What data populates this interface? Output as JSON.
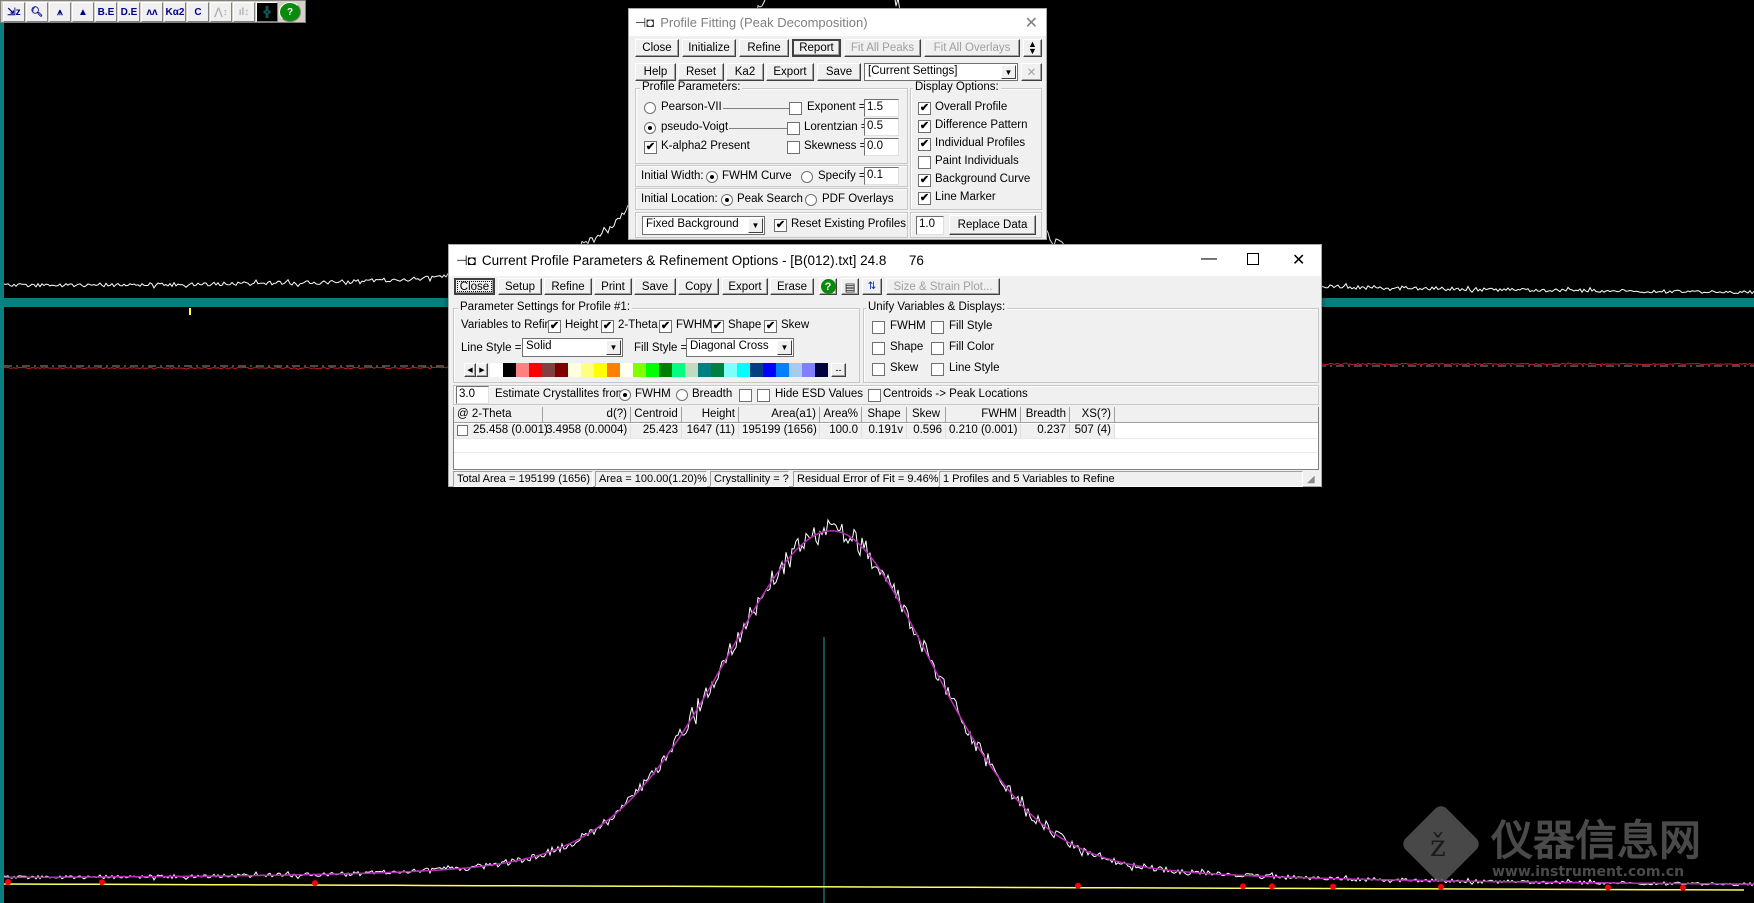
{
  "colors": {
    "panel_divider": "#0b7f7f",
    "data_trace": "#ffffff",
    "fit_trace": "#b030b0",
    "background_curve": "#ffff66",
    "difference_trace": "#cc2020",
    "line_marker": "#20a0a0",
    "markers": "#ff0000"
  },
  "toolbar": {
    "buttons": [
      {
        "icon": "zoom-select-icon",
        "glyph": "⇲z",
        "enabled": true
      },
      {
        "icon": "magnifier-icon",
        "glyph": "🔍︎",
        "enabled": true
      },
      {
        "icon": "peak-marker-icon",
        "glyph": "⩚",
        "enabled": true
      },
      {
        "icon": "filled-peaks-icon",
        "glyph": "▲",
        "enabled": true
      },
      {
        "icon": "background-edit-icon",
        "glyph": "B.E",
        "enabled": true
      },
      {
        "icon": "data-edit-icon",
        "glyph": "D.E",
        "enabled": true
      },
      {
        "icon": "peak-outline-icon",
        "glyph": "ʌʌ",
        "enabled": true
      },
      {
        "icon": "ka2-icon",
        "glyph": "Kα2",
        "enabled": true
      },
      {
        "icon": "centroid-icon",
        "glyph": "C",
        "enabled": true
      },
      {
        "icon": "scale-peaks-icon",
        "glyph": "⋀↕",
        "enabled": false
      },
      {
        "icon": "scale-bars-icon",
        "glyph": "ıl↕",
        "enabled": false
      },
      {
        "icon": "grid-icon",
        "glyph": "╬",
        "enabled": true
      },
      {
        "icon": "help-icon",
        "glyph": "?",
        "enabled": true
      }
    ]
  },
  "profile_fitting": {
    "title": "Profile Fitting (Peak Decomposition)",
    "row1": [
      "Close",
      "Initialize",
      "Refine",
      "Report",
      "Fit All Peaks",
      "Fit All Overlays"
    ],
    "row2": [
      "Help",
      "Reset",
      "Ka2",
      "Export",
      "Save"
    ],
    "settings_select": "[Current Settings]",
    "profile_parameters": {
      "label": "Profile Parameters:",
      "pearson": {
        "label": "Pearson-VII",
        "selected": false
      },
      "pseudo": {
        "label": "pseudo-Voigt",
        "selected": true
      },
      "kalpha2": {
        "label": "K-alpha2 Present",
        "checked": true
      },
      "exponent": {
        "label": "Exponent =",
        "checked": false,
        "value": "1.5"
      },
      "lorentzian": {
        "label": "Lorentzian =",
        "checked": false,
        "value": "0.5"
      },
      "skewness": {
        "label": "Skewness =",
        "checked": false,
        "value": "0.0"
      }
    },
    "initial_width": {
      "label": "Initial Width:",
      "fwhm": {
        "label": "FWHM Curve",
        "selected": true
      },
      "specify": {
        "label": "Specify =",
        "selected": false
      },
      "value": "0.1"
    },
    "initial_location": {
      "label": "Initial Location:",
      "peak": {
        "label": "Peak Search",
        "selected": true
      },
      "pdf": {
        "label": "PDF Overlays",
        "selected": false
      }
    },
    "background_select": "Fixed Background",
    "reset_profiles": {
      "label": "Reset Existing Profiles",
      "checked": true
    },
    "display_options": {
      "label": "Display Options:",
      "items": [
        {
          "label": "Overall Profile",
          "checked": true
        },
        {
          "label": "Difference Pattern",
          "checked": true
        },
        {
          "label": "Individual Profiles",
          "checked": true
        },
        {
          "label": "Paint Individuals",
          "checked": false
        },
        {
          "label": "Background Curve",
          "checked": true
        },
        {
          "label": "Line Marker",
          "checked": true
        }
      ]
    },
    "scale_value": "1.0",
    "replace_data": "Replace Data"
  },
  "current_profile": {
    "title": "Current Profile Parameters & Refinement Options - [B(012).txt] 24.8      76",
    "toolbar": [
      "Close",
      "Setup",
      "Refine",
      "Print",
      "Save",
      "Copy",
      "Export",
      "Erase"
    ],
    "size_strain": "Size & Strain Plot...",
    "param_group": "Parameter Settings for Profile #1:",
    "variables_label": "Variables to Refine:",
    "variables": [
      {
        "label": "Height",
        "checked": true
      },
      {
        "label": "2-Theta",
        "checked": true
      },
      {
        "label": "FWHM",
        "checked": true
      },
      {
        "label": "Shape",
        "checked": true
      },
      {
        "label": "Skew",
        "checked": true
      }
    ],
    "line_style_label": "Line Style =",
    "line_style": "Solid",
    "fill_style_label": "Fill Style =",
    "fill_style": "Diagonal Cross",
    "palette": [
      "#ffffff",
      "#000000",
      "#ff8080",
      "#ff0000",
      "#804040",
      "#800000",
      "#ffffe0",
      "#ffff80",
      "#ffff00",
      "#ff8000",
      "#fffff0",
      "#80ff00",
      "#00ff00",
      "#008000",
      "#00ff80",
      "#c0dcc0",
      "#008080",
      "#008040",
      "#80ffff",
      "#00ffff",
      "#004080",
      "#0000ff",
      "#0080ff",
      "#a6caf0",
      "#8080ff",
      "#000040"
    ],
    "palette_more": "--",
    "unify_group": "Unify Variables & Displays:",
    "unify": [
      {
        "label": "FWHM",
        "checked": false
      },
      {
        "label": "Fill Style",
        "checked": false
      },
      {
        "label": "Shape",
        "checked": false
      },
      {
        "label": "Fill Color",
        "checked": false
      },
      {
        "label": "Skew",
        "checked": false
      },
      {
        "label": "Line Style",
        "checked": false
      }
    ],
    "crystallite_value": "3.0",
    "estimate_label": "Estimate Crystallites from:",
    "fwhm_radio": {
      "label": "FWHM",
      "selected": true
    },
    "breadth_radio": {
      "label": "Breadth",
      "selected": false
    },
    "blank_check": false,
    "hide_esd": {
      "label": "Hide ESD Values",
      "checked": false
    },
    "centroids": {
      "label": "Centroids -> Peak Locations",
      "checked": false
    },
    "columns": [
      "@ 2-Theta",
      "d(?)",
      "Centroid",
      "Height",
      "Area(a1)",
      "Area%",
      "Shape",
      "Skew",
      "FWHM",
      "Breadth",
      "XS(?)"
    ],
    "rows": [
      [
        "25.458 (0.001)",
        "3.4958 (0.0004)",
        "25.423",
        "1647 (11)",
        "195199 (1656)",
        "100.0",
        "0.191v",
        "0.596",
        "0.210 (0.001)",
        "0.237",
        "507 (4)"
      ]
    ],
    "status": [
      "Total Area = 195199 (1656)",
      "Area = 100.00(1.20)%",
      "Crystallinity = ?",
      "Residual Error of Fit = 9.46%",
      "1 Profiles and 5 Variables to Refine"
    ]
  },
  "watermark": {
    "text": "仪器信息网",
    "url_text": "www.instrument.com.cn"
  }
}
